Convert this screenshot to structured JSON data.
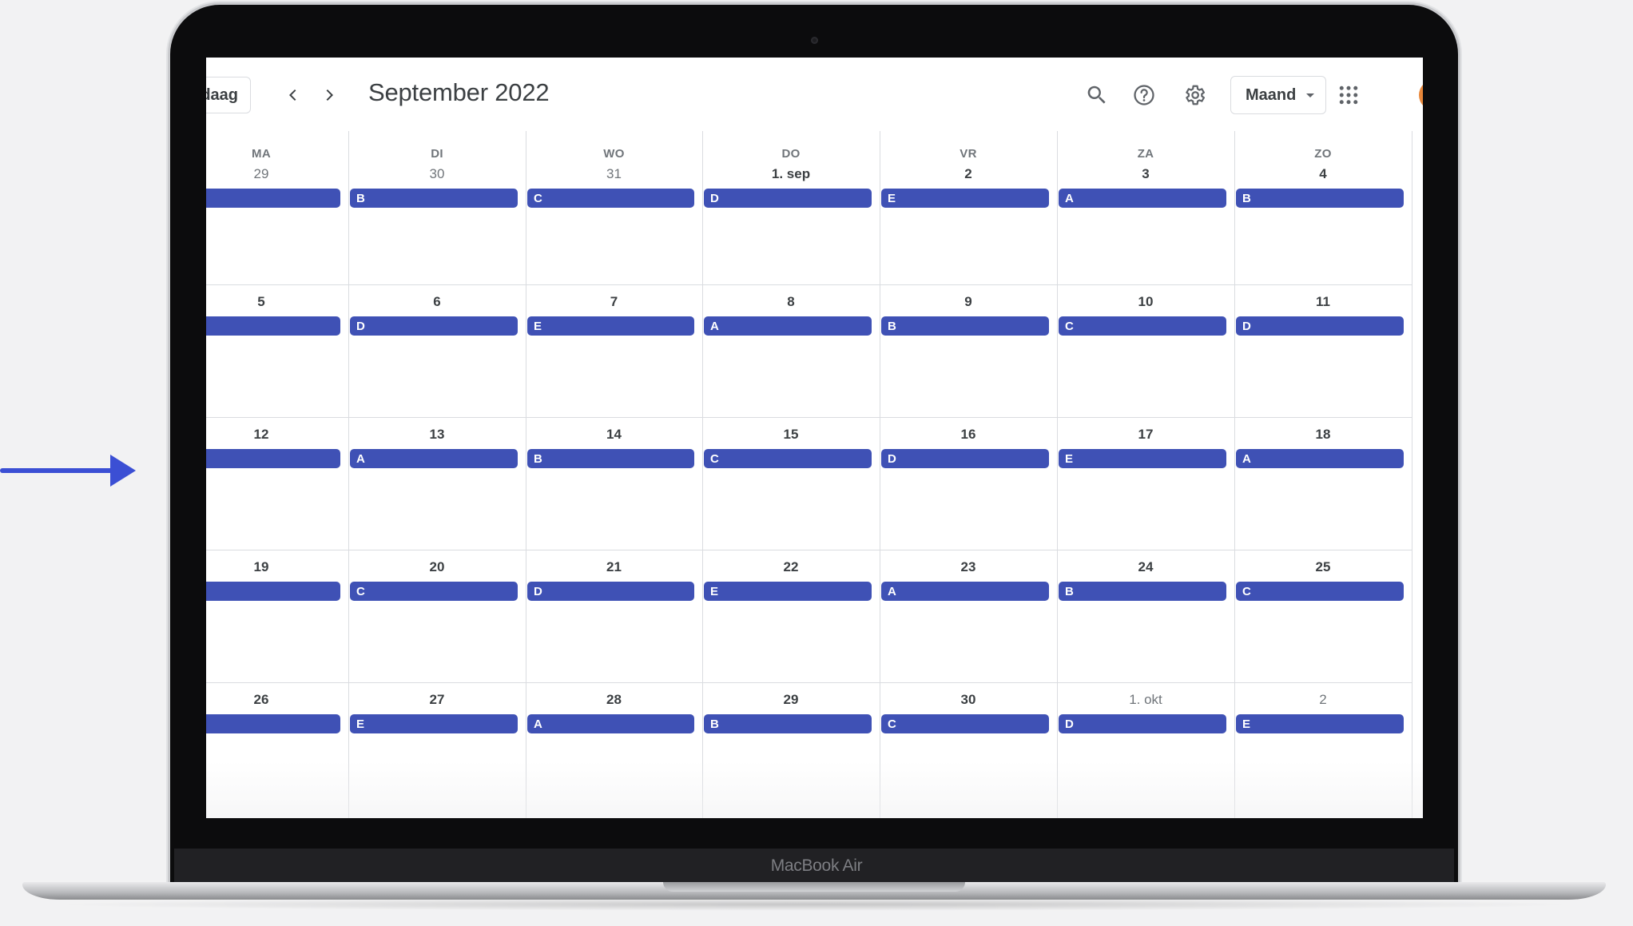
{
  "header": {
    "today_label": "daag",
    "month_title": "September 2022",
    "view_label": "Maand"
  },
  "laptop": {
    "model_label": "MacBook Air"
  },
  "icons": [
    "chevron-left-icon",
    "chevron-right-icon",
    "search-icon",
    "help-icon",
    "gear-icon",
    "apps-grid-icon",
    "caret-down-icon",
    "arrow-right-icon"
  ],
  "colors": {
    "event": "#3f51b5",
    "arrow": "#3b4fd4"
  },
  "weekdays": [
    "MA",
    "DI",
    "WO",
    "DO",
    "VR",
    "ZA",
    "ZO"
  ],
  "weeks": [
    {
      "days": [
        {
          "label": "29",
          "muted": true,
          "event": ""
        },
        {
          "label": "30",
          "muted": true,
          "event": "B"
        },
        {
          "label": "31",
          "muted": true,
          "event": "C"
        },
        {
          "label": "1. sep",
          "muted": false,
          "event": "D"
        },
        {
          "label": "2",
          "muted": false,
          "event": "E"
        },
        {
          "label": "3",
          "muted": false,
          "event": "A"
        },
        {
          "label": "4",
          "muted": false,
          "event": "B"
        }
      ]
    },
    {
      "days": [
        {
          "label": "5",
          "muted": false,
          "event": ""
        },
        {
          "label": "6",
          "muted": false,
          "event": "D"
        },
        {
          "label": "7",
          "muted": false,
          "event": "E"
        },
        {
          "label": "8",
          "muted": false,
          "event": "A"
        },
        {
          "label": "9",
          "muted": false,
          "event": "B"
        },
        {
          "label": "10",
          "muted": false,
          "event": "C"
        },
        {
          "label": "11",
          "muted": false,
          "event": "D"
        }
      ]
    },
    {
      "days": [
        {
          "label": "12",
          "muted": false,
          "event": ""
        },
        {
          "label": "13",
          "muted": false,
          "event": "A"
        },
        {
          "label": "14",
          "muted": false,
          "event": "B"
        },
        {
          "label": "15",
          "muted": false,
          "event": "C"
        },
        {
          "label": "16",
          "muted": false,
          "event": "D"
        },
        {
          "label": "17",
          "muted": false,
          "event": "E"
        },
        {
          "label": "18",
          "muted": false,
          "event": "A"
        }
      ]
    },
    {
      "days": [
        {
          "label": "19",
          "muted": false,
          "event": ""
        },
        {
          "label": "20",
          "muted": false,
          "event": "C"
        },
        {
          "label": "21",
          "muted": false,
          "event": "D"
        },
        {
          "label": "22",
          "muted": false,
          "event": "E"
        },
        {
          "label": "23",
          "muted": false,
          "event": "A"
        },
        {
          "label": "24",
          "muted": false,
          "event": "B"
        },
        {
          "label": "25",
          "muted": false,
          "event": "C"
        }
      ]
    },
    {
      "days": [
        {
          "label": "26",
          "muted": false,
          "event": ""
        },
        {
          "label": "27",
          "muted": false,
          "event": "E"
        },
        {
          "label": "28",
          "muted": false,
          "event": "A"
        },
        {
          "label": "29",
          "muted": false,
          "event": "B"
        },
        {
          "label": "30",
          "muted": false,
          "event": "C"
        },
        {
          "label": "1. okt",
          "muted": true,
          "event": "D"
        },
        {
          "label": "2",
          "muted": true,
          "event": "E"
        }
      ]
    }
  ]
}
